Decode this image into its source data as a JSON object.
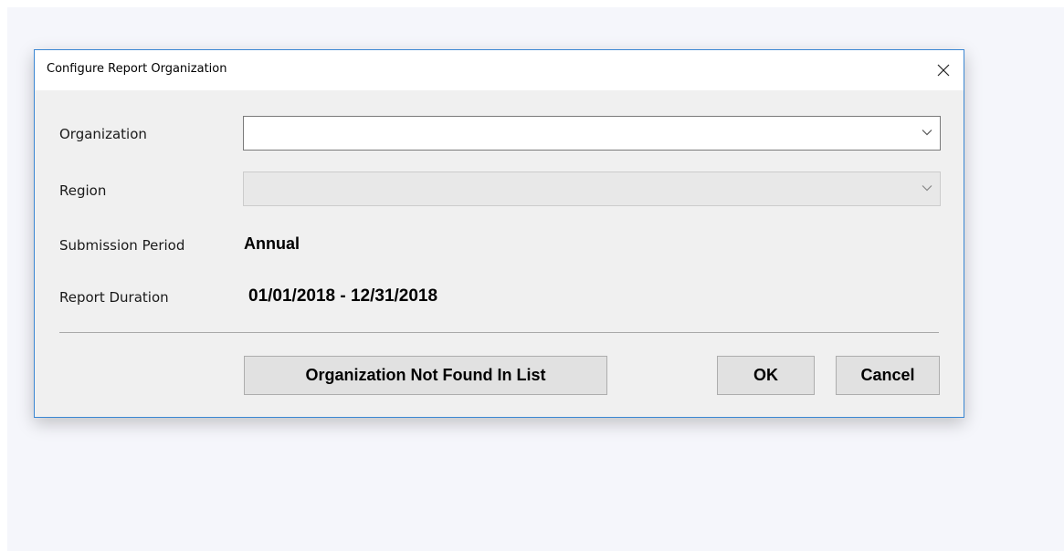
{
  "dialog": {
    "title": "Configure Report Organization",
    "close_glyph": "✕"
  },
  "form": {
    "organization": {
      "label": "Organization",
      "value": ""
    },
    "region": {
      "label": "Region",
      "value": "",
      "disabled": true
    },
    "submission_period": {
      "label": "Submission Period",
      "value": "Annual"
    },
    "report_duration": {
      "label": "Report Duration",
      "value": "01/01/2018 - 12/31/2018"
    }
  },
  "buttons": {
    "not_found_label": "Organization Not Found In List",
    "ok_label": "OK",
    "cancel_label": "Cancel"
  },
  "icons": {
    "close": "close-icon",
    "dropdown": "chevron-down-icon"
  },
  "colors": {
    "dialog_border": "#3b87d3",
    "dialog_body": "#f0f0f0",
    "button_face": "#e1e1e1",
    "backdrop": "#f5f6fb"
  }
}
